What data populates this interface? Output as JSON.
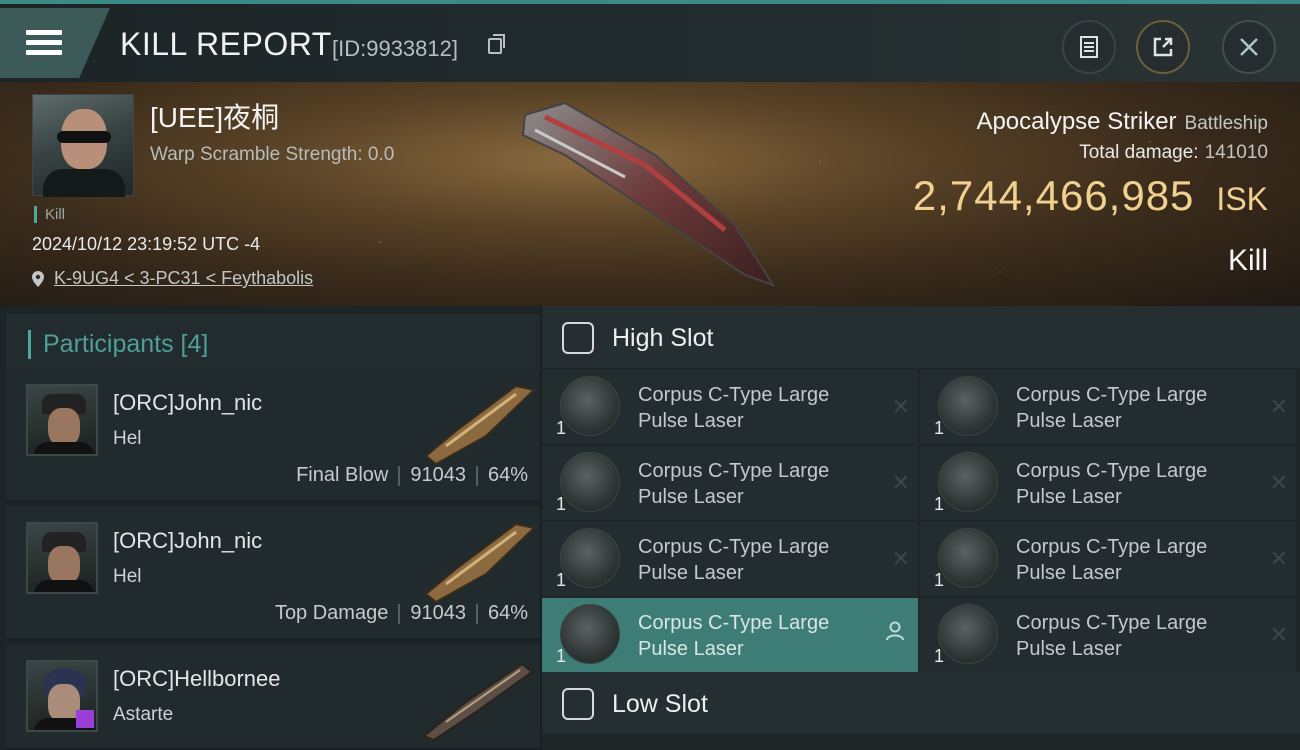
{
  "header": {
    "title": "KILL REPORT",
    "id_label": "[ID:9933812]"
  },
  "victim": {
    "name": "[UEE]夜桐",
    "warp_scramble": "Warp Scramble Strength: 0.0",
    "tag": "Kill",
    "datetime": "2024/10/12 23:19:52 UTC -4",
    "location": "K-9UG4 < 3-PC31 < Feythabolis",
    "ship_name": "Apocalypse Striker",
    "ship_class": "Battleship",
    "total_damage_label": "Total damage:",
    "total_damage_value": "141010",
    "isk_value": "2,744,466,985",
    "isk_unit": "ISK",
    "result": "Kill"
  },
  "participants": {
    "title": "Participants [4]",
    "rows": [
      {
        "name": "[ORC]John_nic",
        "ship": "Hel",
        "role": "Final Blow",
        "damage": "91043",
        "percent": "64%"
      },
      {
        "name": "[ORC]John_nic",
        "ship": "Hel",
        "role": "Top Damage",
        "damage": "91043",
        "percent": "64%"
      },
      {
        "name": "[ORC]Hellbornee",
        "ship": "Astarte"
      }
    ]
  },
  "high_slot": {
    "title": "High Slot",
    "modules": [
      {
        "qty": "1",
        "name": "Corpus C-Type Large Pulse Laser",
        "state": "destroyed"
      },
      {
        "qty": "1",
        "name": "Corpus C-Type Large Pulse Laser",
        "state": "destroyed"
      },
      {
        "qty": "1",
        "name": "Corpus C-Type Large Pulse Laser",
        "state": "destroyed"
      },
      {
        "qty": "1",
        "name": "Corpus C-Type Large Pulse Laser",
        "state": "destroyed"
      },
      {
        "qty": "1",
        "name": "Corpus C-Type Large Pulse Laser",
        "state": "destroyed"
      },
      {
        "qty": "1",
        "name": "Corpus C-Type Large Pulse Laser",
        "state": "destroyed"
      },
      {
        "qty": "1",
        "name": "Corpus C-Type Large Pulse Laser",
        "state": "dropped"
      },
      {
        "qty": "1",
        "name": "Corpus C-Type Large Pulse Laser",
        "state": "destroyed"
      }
    ]
  },
  "low_slot": {
    "title": "Low Slot"
  },
  "icons": {
    "menu": "menu-icon",
    "copy": "copy-icon",
    "clipboard": "clipboard-icon",
    "share": "share-icon",
    "close": "close-icon",
    "location": "location-pin-icon",
    "slot": "slot-icon",
    "destroyed": "destroyed-x-icon",
    "dropped": "user-icon"
  },
  "colors": {
    "accent": "#4fa89f",
    "isk": "#f1d18f",
    "active_module": "#3e7d76"
  }
}
